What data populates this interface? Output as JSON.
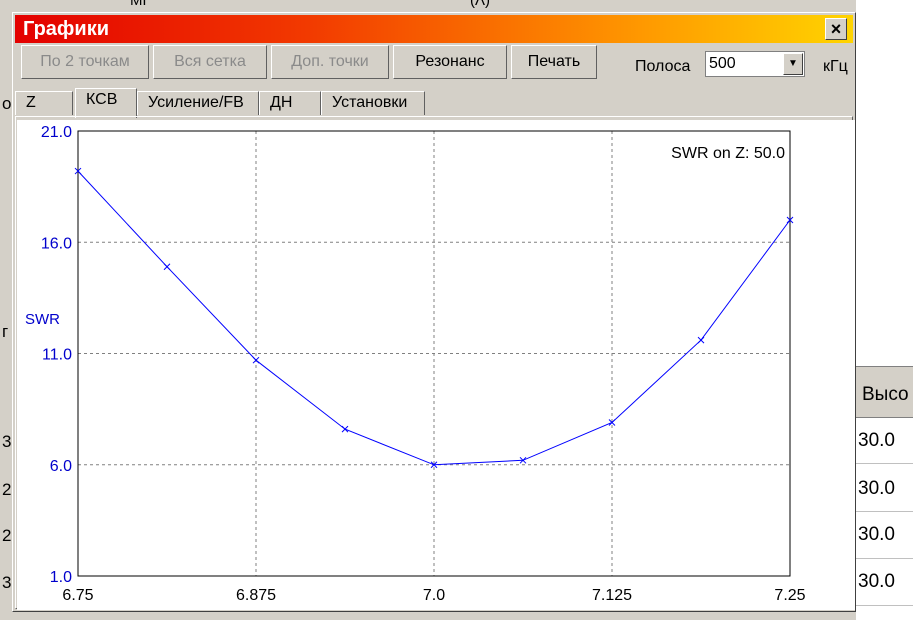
{
  "window": {
    "title": "Графики",
    "close_glyph": "×"
  },
  "toolbar": {
    "by_two_points": "По 2 точкам",
    "whole_grid": "Вся сетка",
    "extra_points": "Доп. точки",
    "resonance": "Резонанс",
    "print": "Печать",
    "band_label": "Полоса",
    "band_value": "500",
    "band_unit": "кГц"
  },
  "tabs": [
    {
      "label": "Z",
      "active": false
    },
    {
      "label": "КСВ",
      "active": true
    },
    {
      "label": "Усиление/FB",
      "active": false
    },
    {
      "label": "ДН",
      "active": false
    },
    {
      "label": "Установки",
      "active": false
    }
  ],
  "background": {
    "column_header": "Высо",
    "cells": [
      "30.0",
      "30.0",
      "30.0",
      "30.0"
    ],
    "left_fragments": [
      "о",
      "г",
      "3",
      "2",
      "2",
      "3"
    ],
    "top_fragments": [
      "МГ",
      "(Λ)"
    ]
  },
  "chart_data": {
    "type": "line",
    "annotation": "SWR on Z: 50.0",
    "ylabel": "SWR",
    "xlabel": "",
    "xlim": [
      6.75,
      7.25
    ],
    "ylim": [
      1.0,
      21.0
    ],
    "x_ticks": [
      "6.75",
      "6.875",
      "7.0",
      "7.125",
      "7.25"
    ],
    "y_ticks": [
      "1.0",
      "6.0",
      "11.0",
      "16.0",
      "21.0"
    ],
    "grid": true,
    "line_color": "#0000ff",
    "series": [
      {
        "x": [
          6.75,
          6.8125,
          6.875,
          6.9375,
          7.0,
          7.0625,
          7.125,
          7.1875,
          7.25
        ],
        "y": [
          19.2,
          14.9,
          10.7,
          7.6,
          6.0,
          6.2,
          7.9,
          11.6,
          17.0
        ]
      }
    ]
  }
}
